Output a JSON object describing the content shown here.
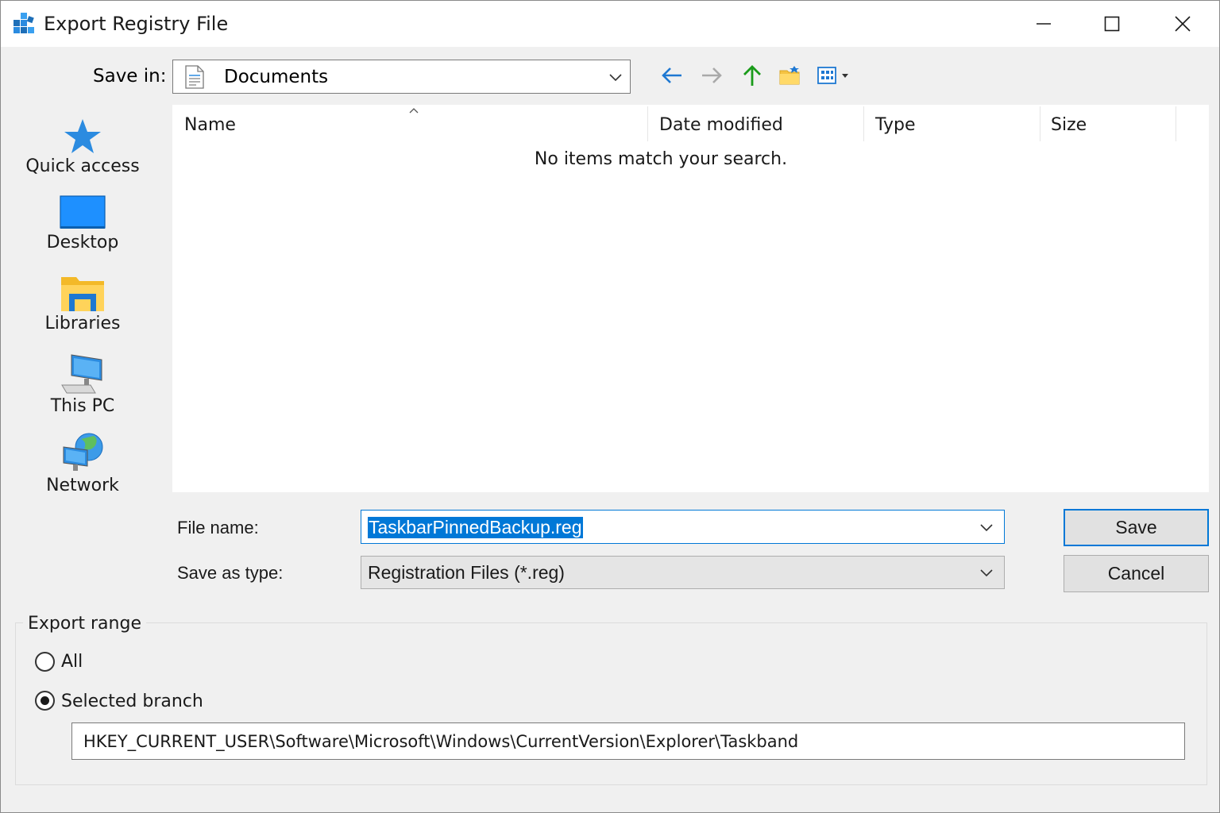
{
  "window": {
    "title": "Export Registry File",
    "app_icon": "regedit-icon",
    "controls": [
      "minimize-icon",
      "maximize-icon",
      "close-icon"
    ]
  },
  "save_in": {
    "label": "Save in:",
    "value": "Documents",
    "icon": "documents-icon"
  },
  "toolbar": {
    "icons": [
      "back-arrow-icon",
      "forward-arrow-icon",
      "up-arrow-icon",
      "new-folder-icon",
      "view-menu-icon"
    ]
  },
  "places": [
    {
      "label": "Quick access",
      "icon": "star-icon"
    },
    {
      "label": "Desktop",
      "icon": "desktop-icon"
    },
    {
      "label": "Libraries",
      "icon": "libraries-folder-icon"
    },
    {
      "label": "This PC",
      "icon": "computer-icon"
    },
    {
      "label": "Network",
      "icon": "network-globe-icon"
    }
  ],
  "file_list": {
    "columns": [
      "Name",
      "Date modified",
      "Type",
      "Size"
    ],
    "empty_message": "No items match your search."
  },
  "file_name": {
    "label": "File name:",
    "value": "TaskbarPinnedBackup.reg"
  },
  "save_as_type": {
    "label": "Save as type:",
    "value": "Registration Files (*.reg)"
  },
  "buttons": {
    "save": "Save",
    "cancel": "Cancel"
  },
  "export_range": {
    "title": "Export range",
    "options": [
      {
        "label": "All",
        "selected": false
      },
      {
        "label": "Selected branch",
        "selected": true
      }
    ],
    "branch_path": "HKEY_CURRENT_USER\\Software\\Microsoft\\Windows\\CurrentVersion\\Explorer\\Taskband"
  },
  "colors": {
    "accent": "#0078d7",
    "dialog_bg": "#f0f0f0",
    "titlebar_bg": "#ffffff"
  }
}
